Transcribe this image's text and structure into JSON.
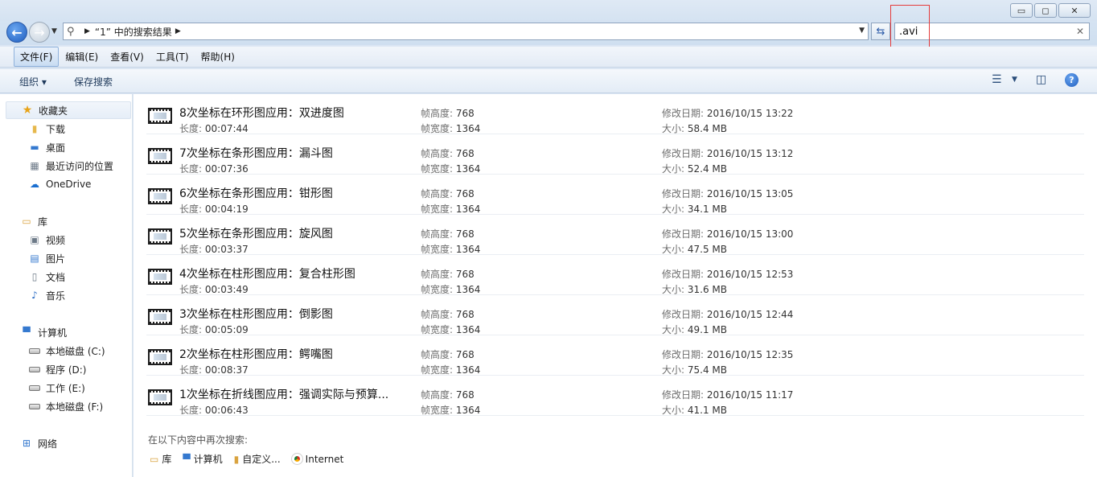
{
  "window": {
    "minimize": "▭",
    "maximize": "◻",
    "close": "✕"
  },
  "address": {
    "icon": "search-icon",
    "path": "“1” 中的搜索结果"
  },
  "search": {
    "value": ".avi"
  },
  "menu": [
    "文件(F)",
    "编辑(E)",
    "查看(V)",
    "工具(T)",
    "帮助(H)"
  ],
  "toolbar": {
    "organize": "组织 ▾",
    "save_search": "保存搜索"
  },
  "sidebar": {
    "favorites": "收藏夹",
    "favorites_items": [
      "下载",
      "桌面",
      "最近访问的位置",
      "OneDrive"
    ],
    "libraries": "库",
    "libraries_items": [
      "视频",
      "图片",
      "文档",
      "音乐"
    ],
    "computer": "计算机",
    "computer_items": [
      "本地磁盘 (C:)",
      "程序 (D:)",
      "工作 (E:)",
      "本地磁盘 (F:)"
    ],
    "network": "网络"
  },
  "labels": {
    "length": "长度:",
    "frame_height": "帧高度:",
    "frame_width": "帧宽度:",
    "modified": "修改日期:",
    "size": "大小:"
  },
  "files": [
    {
      "name": "8次坐标在环形图应用：双进度图",
      "length": "00:07:44",
      "frame_height": "768",
      "frame_width": "1364",
      "modified": "2016/10/15 13:22",
      "size": "58.4 MB"
    },
    {
      "name": "7次坐标在条形图应用：漏斗图",
      "length": "00:07:36",
      "frame_height": "768",
      "frame_width": "1364",
      "modified": "2016/10/15 13:12",
      "size": "52.4 MB"
    },
    {
      "name": "6次坐标在条形图应用：钳形图",
      "length": "00:04:19",
      "frame_height": "768",
      "frame_width": "1364",
      "modified": "2016/10/15 13:05",
      "size": "34.1 MB"
    },
    {
      "name": "5次坐标在条形图应用：旋风图",
      "length": "00:03:37",
      "frame_height": "768",
      "frame_width": "1364",
      "modified": "2016/10/15 13:00",
      "size": "47.5 MB"
    },
    {
      "name": "4次坐标在柱形图应用：复合柱形图",
      "length": "00:03:49",
      "frame_height": "768",
      "frame_width": "1364",
      "modified": "2016/10/15 12:53",
      "size": "31.6 MB"
    },
    {
      "name": "3次坐标在柱形图应用：倒影图",
      "length": "00:05:09",
      "frame_height": "768",
      "frame_width": "1364",
      "modified": "2016/10/15 12:44",
      "size": "49.1 MB"
    },
    {
      "name": "2次坐标在柱形图应用：鳄嘴图",
      "length": "00:08:37",
      "frame_height": "768",
      "frame_width": "1364",
      "modified": "2016/10/15 12:35",
      "size": "75.4 MB"
    },
    {
      "name": "1次坐标在折线图应用：强调实际与预算...",
      "length": "00:06:43",
      "frame_height": "768",
      "frame_width": "1364",
      "modified": "2016/10/15 11:17",
      "size": "41.1 MB"
    }
  ],
  "search_again": {
    "title": "在以下内容中再次搜索:",
    "links": [
      "库",
      "计算机",
      "自定义...",
      "Internet"
    ]
  }
}
